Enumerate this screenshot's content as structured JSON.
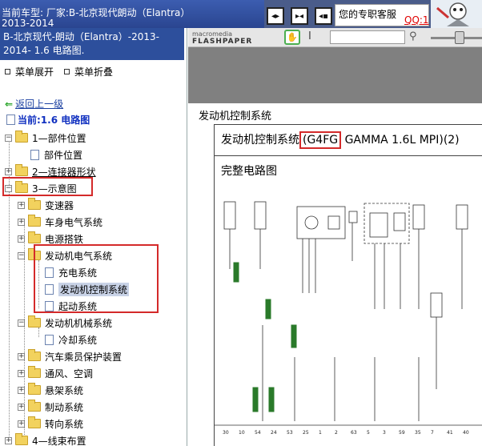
{
  "header": {
    "car_type_line1": "当前车型:  厂家:B-北京现代朗动（Elantra）",
    "car_type_line2": "2013-2014",
    "service_label": "您的专职客服",
    "qq_label": "QQ:1",
    "nav_first_icon": "first-page-icon",
    "nav_prev_next_icon": "prev-next-icon",
    "nav_last_icon": "last-page-icon"
  },
  "left": {
    "doc_title": "B-北京现代-朗动（Elantra）-2013-2014- 1.6 电路图.",
    "menu_expand": "菜单展开",
    "menu_collapse": "菜单折叠",
    "back_link": "返回上一级",
    "current": "当前:1.6 电路图",
    "tree": [
      {
        "label": "1—部件位置"
      },
      {
        "label": "部件位置"
      },
      {
        "label": "2—连接器形状"
      },
      {
        "label": "3—示意图"
      },
      {
        "label": "变速器"
      },
      {
        "label": "车身电气系统"
      },
      {
        "label": "电源搭铁"
      },
      {
        "label": "发动机电气系统"
      },
      {
        "label": "充电系统"
      },
      {
        "label": "发动机控制系统"
      },
      {
        "label": "起动系统"
      },
      {
        "label": "发动机机械系统"
      },
      {
        "label": "冷却系统"
      },
      {
        "label": "汽车乘员保护装置"
      },
      {
        "label": "通风、空调"
      },
      {
        "label": "悬架系统"
      },
      {
        "label": "制动系统"
      },
      {
        "label": "转向系统"
      },
      {
        "label": "4—线束布置"
      }
    ]
  },
  "toolbar": {
    "logo_small": "macromedia",
    "logo_big": "FLASHPAPER",
    "hand_icon": "hand-tool-icon",
    "text_cursor": "I",
    "search_placeholder": "",
    "search_icon": "magnifier-icon"
  },
  "document": {
    "section_title": "发动机控制系统",
    "sheet_title_a": "发动机控制系统",
    "sheet_title_code": "(G4FG",
    "sheet_title_b": " GAMMA 1.6L MPI)(2)",
    "sheet_subtitle": "完整电路图",
    "pins": [
      "30",
      "10",
      "54",
      "24",
      "53",
      "25",
      "1",
      "2",
      "63",
      "5",
      "3",
      "59",
      "35",
      "7",
      "41",
      "40"
    ]
  },
  "colors": {
    "header_blue": "#2d4f9c",
    "highlight_red": "#d42a2a",
    "link_blue": "#1a3fa0"
  }
}
